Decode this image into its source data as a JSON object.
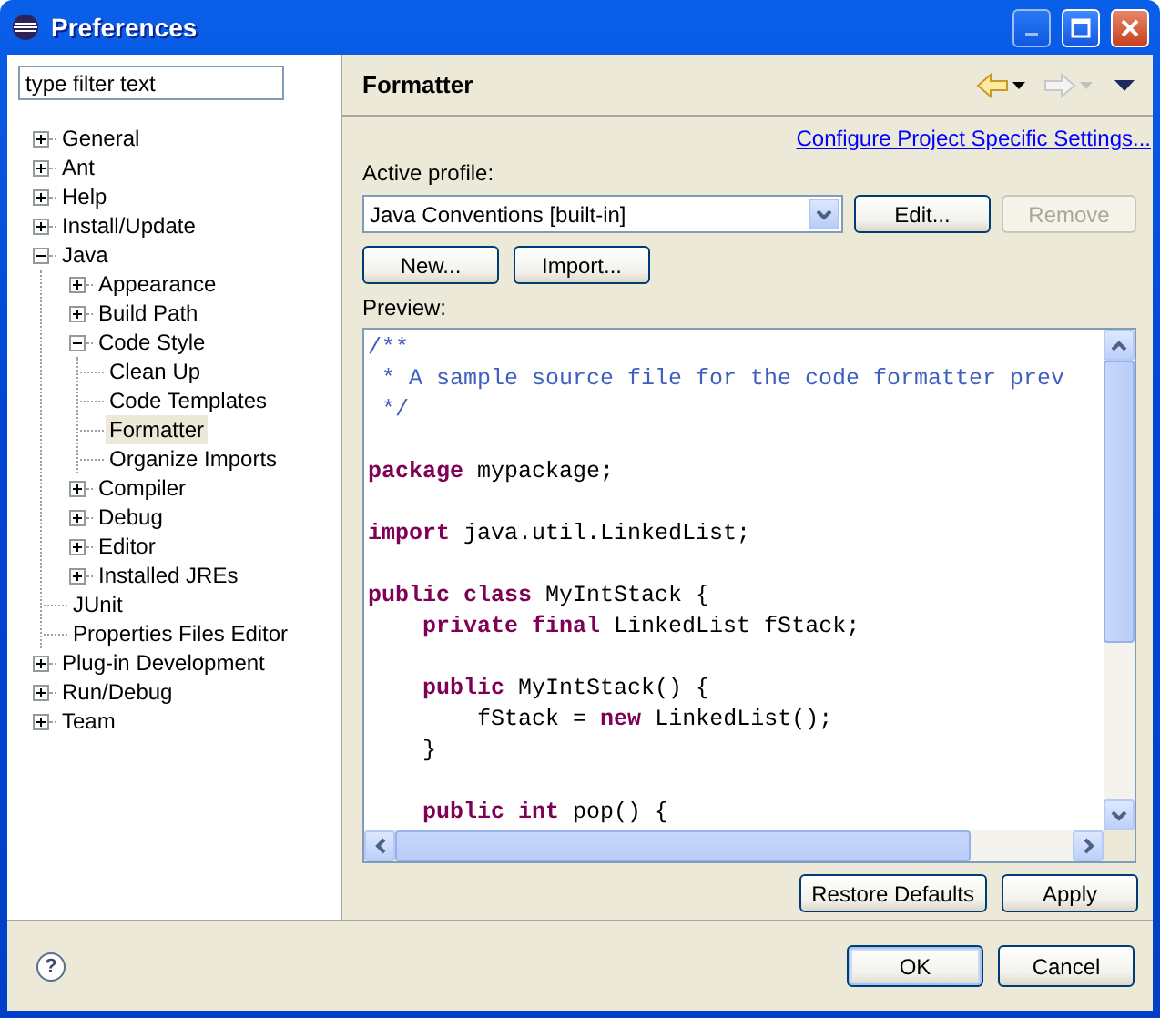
{
  "window": {
    "title": "Preferences"
  },
  "filter": {
    "value": "type filter text"
  },
  "tree": [
    {
      "label": "General",
      "expanded": false,
      "selected": false
    },
    {
      "label": "Ant",
      "expanded": false,
      "selected": false
    },
    {
      "label": "Help",
      "expanded": false,
      "selected": false
    },
    {
      "label": "Install/Update",
      "expanded": false,
      "selected": false
    },
    {
      "label": "Java",
      "expanded": true,
      "selected": false,
      "children": [
        {
          "label": "Appearance",
          "expanded": false,
          "selected": false
        },
        {
          "label": "Build Path",
          "expanded": false,
          "selected": false
        },
        {
          "label": "Code Style",
          "expanded": true,
          "selected": false,
          "children": [
            {
              "label": "Clean Up",
              "selected": false
            },
            {
              "label": "Code Templates",
              "selected": false
            },
            {
              "label": "Formatter",
              "selected": true
            },
            {
              "label": "Organize Imports",
              "selected": false
            }
          ]
        },
        {
          "label": "Compiler",
          "expanded": false,
          "selected": false
        },
        {
          "label": "Debug",
          "expanded": false,
          "selected": false
        },
        {
          "label": "Editor",
          "expanded": false,
          "selected": false
        },
        {
          "label": "Installed JREs",
          "expanded": false,
          "selected": false
        },
        {
          "label": "JUnit",
          "selected": false
        },
        {
          "label": "Properties Files Editor",
          "selected": false
        }
      ]
    },
    {
      "label": "Plug-in Development",
      "expanded": false,
      "selected": false
    },
    {
      "label": "Run/Debug",
      "expanded": false,
      "selected": false
    },
    {
      "label": "Team",
      "expanded": false,
      "selected": false
    }
  ],
  "page": {
    "title": "Formatter",
    "back_disabled": false,
    "forward_disabled": true,
    "link": "Configure Project Specific Settings...",
    "profile_label": "Active profile:",
    "profile": "Java Conventions [built-in]",
    "profile_buttons": [
      {
        "label": "Edit...",
        "disabled": false
      },
      {
        "label": "Remove",
        "disabled": true
      }
    ],
    "buttons": [
      {
        "label": "New...",
        "disabled": false
      },
      {
        "label": "Import...",
        "disabled": false
      }
    ],
    "preview_label": "Preview:",
    "code": [
      {
        "kind": "code",
        "segments": [
          {
            "kind": "comment",
            "text": "/**"
          }
        ]
      },
      {
        "kind": "code",
        "segments": [
          {
            "kind": "comment",
            "text": " * A sample source file for the code formatter prev"
          }
        ]
      },
      {
        "kind": "code",
        "segments": [
          {
            "kind": "comment",
            "text": " */"
          }
        ]
      },
      {
        "kind": "blank"
      },
      {
        "kind": "code",
        "segments": [
          {
            "kind": "keyword",
            "text": "package"
          },
          {
            "kind": "plain",
            "text": "mypackage;"
          }
        ]
      },
      {
        "kind": "blank"
      },
      {
        "kind": "code",
        "segments": [
          {
            "kind": "keyword",
            "text": "import"
          },
          {
            "kind": "plain",
            "text": "java.util.LinkedList;"
          }
        ]
      },
      {
        "kind": "blank"
      },
      {
        "kind": "code",
        "segments": [
          {
            "kind": "keyword",
            "text": "public class"
          },
          {
            "kind": "plain",
            "text": "MyIntStack {"
          }
        ],
        "children": [
          {
            "kind": "code",
            "segments": [
              {
                "kind": "keyword",
                "text": "private final"
              },
              {
                "kind": "plain",
                "text": "LinkedList fStack;"
              }
            ]
          },
          {
            "kind": "blank"
          },
          {
            "kind": "code",
            "segments": [
              {
                "kind": "keyword",
                "text": "public"
              },
              {
                "kind": "plain",
                "text": "MyIntStack() {"
              }
            ],
            "children": [
              {
                "kind": "code",
                "segments": [
                  {
                    "kind": "plain",
                    "text": "fStack ="
                  },
                  {
                    "kind": "keyword",
                    "text": "new"
                  },
                  {
                    "kind": "plain",
                    "text": "LinkedList();"
                  }
                ]
              }
            ]
          },
          {
            "kind": "code",
            "segments": [
              {
                "kind": "plain",
                "text": "}"
              }
            ]
          },
          {
            "kind": "blank"
          },
          {
            "kind": "code",
            "segments": [
              {
                "kind": "keyword",
                "text": "public int"
              },
              {
                "kind": "plain",
                "text": "pop() {"
              }
            ]
          }
        ]
      }
    ],
    "page_buttons": [
      {
        "label": "Restore Defaults",
        "disabled": false
      },
      {
        "label": "Apply",
        "disabled": false
      }
    ]
  },
  "dialog_buttons": [
    {
      "label": "OK",
      "default": true
    },
    {
      "label": "Cancel",
      "default": false
    }
  ],
  "help": {
    "glyph": "?"
  }
}
